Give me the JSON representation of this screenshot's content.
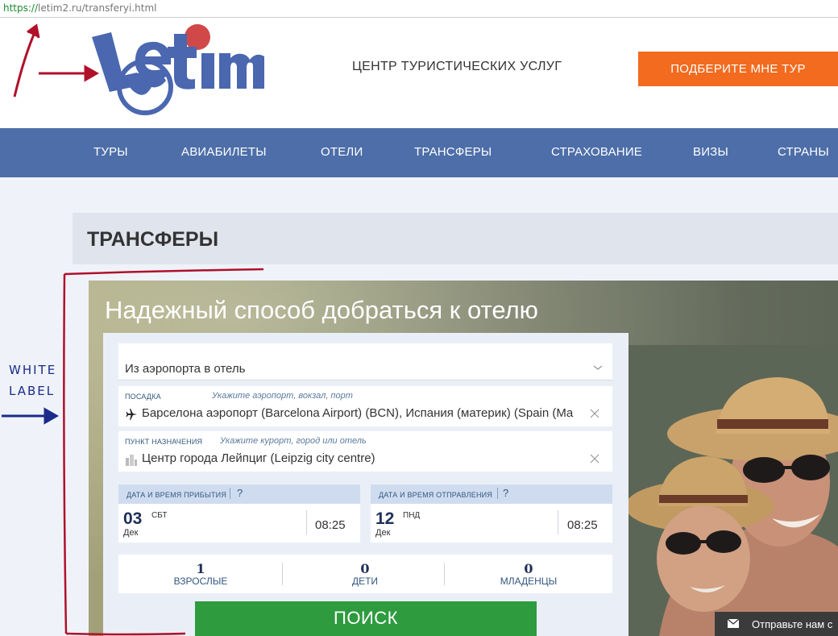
{
  "browser": {
    "url_scheme": "https://",
    "url_rest": "letim2.ru/transferyi.html"
  },
  "header": {
    "logo_text": "letim",
    "tagline": "ЦЕНТР ТУРИСТИЧЕСКИХ УСЛУГ",
    "cta_label": "ПОДБЕРИТЕ МНЕ ТУР"
  },
  "nav": {
    "items": [
      "ТУРЫ",
      "АВИАБИЛЕТЫ",
      "ОТЕЛИ",
      "ТРАНСФЕРЫ",
      "СТРАХОВАНИЕ",
      "ВИЗЫ",
      "СТРАНЫ"
    ]
  },
  "page": {
    "section_title": "ТРАНСФЕРЫ"
  },
  "hero": {
    "title": "Надежный способ добраться к отелю"
  },
  "form": {
    "direction": "Из аэропорта в отель",
    "pickup": {
      "label": "ПОСАДКА",
      "hint": "Укажите аэропорт, вокзал, порт",
      "value": "Барселона   аэропорт (Barcelona Airport) (BCN), Испания (материк) (Spain (Ma"
    },
    "destination": {
      "label": "ПУНКТ НАЗНАЧЕНИЯ",
      "hint": "Укажите курорт, город или отель",
      "value": "Центр города Лейпциг (Leipzig city centre)"
    },
    "arrival": {
      "label": "ДАТА И ВРЕМЯ ПРИБЫТИЯ",
      "help": "?",
      "day": "03",
      "weekday": "СБТ",
      "month": "Дек",
      "time": "08:25"
    },
    "departure": {
      "label": "ДАТА И ВРЕМЯ ОТПРАВЛЕНИЯ",
      "help": "?",
      "day": "12",
      "weekday": "ПНД",
      "month": "Дек",
      "time": "08:25"
    },
    "passengers": [
      {
        "count": "1",
        "label": "ВЗРОСЛЫЕ"
      },
      {
        "count": "0",
        "label": "ДЕТИ"
      },
      {
        "count": "0",
        "label": "МЛАДЕНЦЫ"
      }
    ],
    "search_label": "ПОИСК"
  },
  "feedback": {
    "label": "Отправьте нам с"
  },
  "annotation": {
    "line1": "WHITE",
    "line2": "LABEL"
  },
  "colors": {
    "nav_bg": "#4d6ea8",
    "cta_orange": "#f26b1f",
    "search_green": "#2e9b3f",
    "logo_blue": "#4a67b0",
    "logo_red": "#d04848",
    "annotation_red": "#b0102a",
    "annotation_blue": "#1c2a8a"
  }
}
